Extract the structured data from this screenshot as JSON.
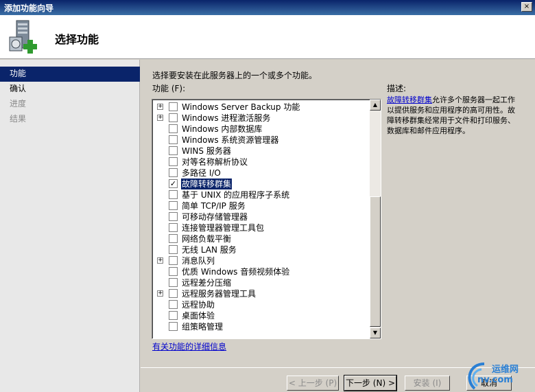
{
  "window": {
    "title": "添加功能向导",
    "close": "×"
  },
  "header": {
    "title": "选择功能"
  },
  "nav": [
    {
      "label": "功能",
      "state": "active"
    },
    {
      "label": "确认",
      "state": "normal"
    },
    {
      "label": "进度",
      "state": "disabled"
    },
    {
      "label": "结果",
      "state": "disabled"
    }
  ],
  "main": {
    "instruction": "选择要安装在此服务器上的一个或多个功能。",
    "list_label": "功能 (F):",
    "features": [
      {
        "label": "Windows Server Backup 功能",
        "expandable": true,
        "checked": false,
        "selected": false
      },
      {
        "label": "Windows 进程激活服务",
        "expandable": true,
        "checked": false,
        "selected": false
      },
      {
        "label": "Windows 内部数据库",
        "expandable": false,
        "checked": false,
        "selected": false
      },
      {
        "label": "Windows 系统资源管理器",
        "expandable": false,
        "checked": false,
        "selected": false
      },
      {
        "label": "WINS 服务器",
        "expandable": false,
        "checked": false,
        "selected": false
      },
      {
        "label": "对等名称解析协议",
        "expandable": false,
        "checked": false,
        "selected": false
      },
      {
        "label": "多路径 I/O",
        "expandable": false,
        "checked": false,
        "selected": false
      },
      {
        "label": "故障转移群集",
        "expandable": false,
        "checked": true,
        "selected": true
      },
      {
        "label": "基于 UNIX 的应用程序子系统",
        "expandable": false,
        "checked": false,
        "selected": false
      },
      {
        "label": "简单 TCP/IP 服务",
        "expandable": false,
        "checked": false,
        "selected": false
      },
      {
        "label": "可移动存储管理器",
        "expandable": false,
        "checked": false,
        "selected": false
      },
      {
        "label": "连接管理器管理工具包",
        "expandable": false,
        "checked": false,
        "selected": false
      },
      {
        "label": "网络负载平衡",
        "expandable": false,
        "checked": false,
        "selected": false
      },
      {
        "label": "无线 LAN 服务",
        "expandable": false,
        "checked": false,
        "selected": false
      },
      {
        "label": "消息队列",
        "expandable": true,
        "checked": false,
        "selected": false
      },
      {
        "label": "优质 Windows 音频视频体验",
        "expandable": false,
        "checked": false,
        "selected": false
      },
      {
        "label": "远程差分压缩",
        "expandable": false,
        "checked": false,
        "selected": false
      },
      {
        "label": "远程服务器管理工具",
        "expandable": true,
        "checked": false,
        "selected": false
      },
      {
        "label": "远程协助",
        "expandable": false,
        "checked": false,
        "selected": false
      },
      {
        "label": "桌面体验",
        "expandable": false,
        "checked": false,
        "selected": false
      },
      {
        "label": "组策略管理",
        "expandable": false,
        "checked": false,
        "selected": false
      }
    ],
    "more_info_link": "有关功能的详细信息",
    "description": {
      "label": "描述:",
      "link": "故障转移群集",
      "text": "允许多个服务器一起工作以提供服务和应用程序的高可用性。故障转移群集经常用于文件和打印服务、数据库和邮件应用程序。"
    }
  },
  "buttons": {
    "back": "< 上一步 (P)",
    "next": "下一步 (N) >",
    "install": "安装 (I)",
    "cancel": "取消"
  },
  "watermark": {
    "line1": "运维网",
    "line2": "nv.com"
  },
  "colors": {
    "selection": "#0a246a",
    "link": "#0000cc"
  }
}
